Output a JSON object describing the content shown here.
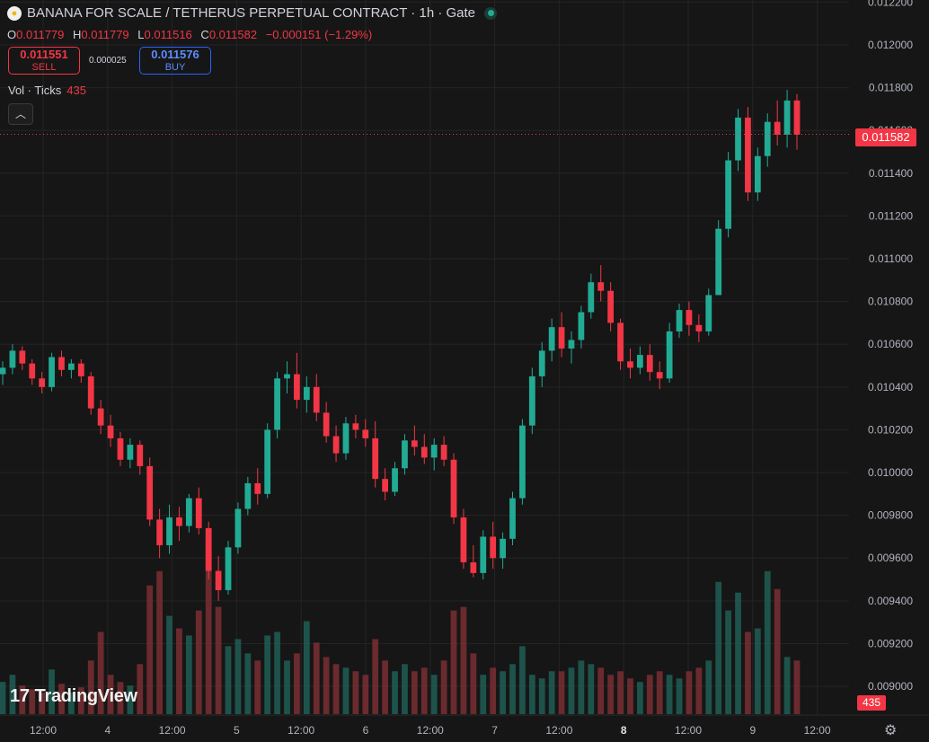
{
  "header": {
    "title": "BANANA FOR SCALE / TETHERUS PERPETUAL CONTRACT · 1h · Gate",
    "ohlc": [
      {
        "k": "O",
        "v": "0.011779"
      },
      {
        "k": "H",
        "v": "0.011779"
      },
      {
        "k": "L",
        "v": "0.011516"
      },
      {
        "k": "C",
        "v": "0.011582"
      },
      {
        "k": "",
        "v": "−0.000151 (−1.29%)"
      }
    ]
  },
  "trade": {
    "sell_price": "0.011551",
    "sell_label": "SELL",
    "spread": "0.000025",
    "buy_price": "0.011576",
    "buy_label": "BUY"
  },
  "volume_legend": {
    "label": "Vol · Ticks",
    "value": "435"
  },
  "collapse_icon": "chevron-up-icon",
  "last_price_label": "0.011582",
  "last_volume_label": "435",
  "branding": "TradingView",
  "settings_icon": "gear-icon",
  "colors": {
    "up": "#22ab94",
    "down": "#f23645",
    "up_vol": "#1f5e55",
    "down_vol": "#7a2e32",
    "grid": "#242424",
    "background": "#161616"
  },
  "chart_data": {
    "type": "candlestick",
    "timeframe": "1h",
    "y_ticks": [
      "0.012200",
      "0.012000",
      "0.011800",
      "0.011600",
      "0.011400",
      "0.011200",
      "0.011000",
      "0.010800",
      "0.010600",
      "0.010400",
      "0.010200",
      "0.010000",
      "0.009800",
      "0.009600",
      "0.009400",
      "0.009200",
      "0.009000"
    ],
    "x_ticks": [
      "12:00",
      "4",
      "12:00",
      "5",
      "12:00",
      "6",
      "12:00",
      "7",
      "12:00",
      "8",
      "12:00",
      "9",
      "12:00"
    ],
    "x_ticks_bold": [
      false,
      false,
      false,
      false,
      false,
      false,
      false,
      false,
      false,
      true,
      false,
      false,
      false
    ],
    "ylim": [
      0.00887,
      0.01221
    ],
    "last_price": 0.011582,
    "candles": [
      [
        0.01046,
        0.01052,
        0.01041,
        0.01049
      ],
      [
        0.01049,
        0.0106,
        0.01046,
        0.01057
      ],
      [
        0.01057,
        0.01059,
        0.01048,
        0.01051
      ],
      [
        0.01051,
        0.01053,
        0.01041,
        0.01044
      ],
      [
        0.01044,
        0.01047,
        0.01037,
        0.0104
      ],
      [
        0.0104,
        0.01056,
        0.01038,
        0.01054
      ],
      [
        0.01054,
        0.01057,
        0.01045,
        0.01048
      ],
      [
        0.01048,
        0.01053,
        0.01044,
        0.01051
      ],
      [
        0.01051,
        0.01053,
        0.01042,
        0.01045
      ],
      [
        0.01045,
        0.01047,
        0.01027,
        0.0103
      ],
      [
        0.0103,
        0.01034,
        0.01018,
        0.01022
      ],
      [
        0.01022,
        0.01027,
        0.01012,
        0.01016
      ],
      [
        0.01016,
        0.01019,
        0.01003,
        0.01006
      ],
      [
        0.01006,
        0.01016,
        0.01002,
        0.01013
      ],
      [
        0.01013,
        0.01015,
        0.00999,
        0.01003
      ],
      [
        0.01003,
        0.01007,
        0.00975,
        0.00978
      ],
      [
        0.00978,
        0.00983,
        0.0096,
        0.00966
      ],
      [
        0.00966,
        0.00985,
        0.00962,
        0.00979
      ],
      [
        0.00979,
        0.00984,
        0.00968,
        0.00975
      ],
      [
        0.00975,
        0.0099,
        0.00972,
        0.00988
      ],
      [
        0.00988,
        0.00993,
        0.00971,
        0.00974
      ],
      [
        0.00974,
        0.00977,
        0.0095,
        0.00954
      ],
      [
        0.00954,
        0.00961,
        0.0094,
        0.00945
      ],
      [
        0.00945,
        0.00968,
        0.00943,
        0.00965
      ],
      [
        0.00965,
        0.00986,
        0.00962,
        0.00983
      ],
      [
        0.00983,
        0.00998,
        0.0098,
        0.00995
      ],
      [
        0.00995,
        0.01002,
        0.00985,
        0.0099
      ],
      [
        0.0099,
        0.01023,
        0.00988,
        0.0102
      ],
      [
        0.0102,
        0.01047,
        0.01016,
        0.01044
      ],
      [
        0.01044,
        0.01052,
        0.01037,
        0.01046
      ],
      [
        0.01046,
        0.01056,
        0.0103,
        0.01034
      ],
      [
        0.01034,
        0.01045,
        0.01028,
        0.0104
      ],
      [
        0.0104,
        0.01046,
        0.01024,
        0.01028
      ],
      [
        0.01028,
        0.01033,
        0.01014,
        0.01017
      ],
      [
        0.01017,
        0.01022,
        0.01005,
        0.01009
      ],
      [
        0.01009,
        0.01026,
        0.01006,
        0.01023
      ],
      [
        0.01023,
        0.01027,
        0.01016,
        0.0102
      ],
      [
        0.0102,
        0.01025,
        0.01012,
        0.01016
      ],
      [
        0.01016,
        0.01024,
        0.00993,
        0.00997
      ],
      [
        0.00997,
        0.01002,
        0.00987,
        0.00991
      ],
      [
        0.00991,
        0.01005,
        0.00989,
        0.01002
      ],
      [
        0.01002,
        0.01018,
        0.00999,
        0.01015
      ],
      [
        0.01015,
        0.01022,
        0.01008,
        0.01012
      ],
      [
        0.01012,
        0.01018,
        0.01004,
        0.01007
      ],
      [
        0.01007,
        0.01016,
        0.01001,
        0.01013
      ],
      [
        0.01013,
        0.01017,
        0.01003,
        0.01006
      ],
      [
        0.01006,
        0.01009,
        0.00976,
        0.00979
      ],
      [
        0.00979,
        0.00983,
        0.00955,
        0.00958
      ],
      [
        0.00958,
        0.00966,
        0.00951,
        0.00953
      ],
      [
        0.00953,
        0.00973,
        0.0095,
        0.0097
      ],
      [
        0.0097,
        0.00977,
        0.00955,
        0.0096
      ],
      [
        0.0096,
        0.00972,
        0.00955,
        0.00969
      ],
      [
        0.00969,
        0.00991,
        0.00966,
        0.00988
      ],
      [
        0.00988,
        0.01025,
        0.00985,
        0.01022
      ],
      [
        0.01022,
        0.01049,
        0.01018,
        0.01045
      ],
      [
        0.01045,
        0.01061,
        0.0104,
        0.01057
      ],
      [
        0.01057,
        0.01072,
        0.01052,
        0.01068
      ],
      [
        0.01068,
        0.01075,
        0.01054,
        0.01058
      ],
      [
        0.01058,
        0.01066,
        0.01051,
        0.01062
      ],
      [
        0.01062,
        0.01078,
        0.01058,
        0.01075
      ],
      [
        0.01075,
        0.01093,
        0.01072,
        0.01089
      ],
      [
        0.01089,
        0.01097,
        0.0108,
        0.01085
      ],
      [
        0.01085,
        0.01089,
        0.01066,
        0.0107
      ],
      [
        0.0107,
        0.01072,
        0.01048,
        0.01052
      ],
      [
        0.01052,
        0.01058,
        0.01044,
        0.01049
      ],
      [
        0.01049,
        0.01059,
        0.01046,
        0.01055
      ],
      [
        0.01055,
        0.0106,
        0.01043,
        0.01047
      ],
      [
        0.01047,
        0.01052,
        0.01039,
        0.01044
      ],
      [
        0.01044,
        0.0107,
        0.01042,
        0.01066
      ],
      [
        0.01066,
        0.01079,
        0.01063,
        0.01076
      ],
      [
        0.01076,
        0.0108,
        0.01064,
        0.01069
      ],
      [
        0.01069,
        0.01074,
        0.01061,
        0.01066
      ],
      [
        0.01066,
        0.01086,
        0.01064,
        0.01083
      ],
      [
        0.01083,
        0.01085,
        0.01118,
        0.01114
      ],
      [
        0.01114,
        0.0115,
        0.0111,
        0.01146
      ],
      [
        0.01146,
        0.0117,
        0.01141,
        0.01166
      ],
      [
        0.01166,
        0.01171,
        0.01127,
        0.01131
      ],
      [
        0.01131,
        0.01152,
        0.01127,
        0.01148
      ],
      [
        0.01148,
        0.01168,
        0.01143,
        0.01164
      ],
      [
        0.01164,
        0.01174,
        0.01153,
        0.01158
      ],
      [
        0.01158,
        0.01179,
        0.01152,
        0.01174
      ],
      [
        0.01174,
        0.01177,
        0.01151,
        0.01158
      ]
    ],
    "volumes": [
      18,
      22,
      16,
      14,
      12,
      25,
      17,
      12,
      15,
      30,
      46,
      22,
      18,
      16,
      28,
      72,
      80,
      55,
      48,
      44,
      58,
      98,
      60,
      38,
      42,
      34,
      30,
      44,
      46,
      30,
      34,
      52,
      40,
      32,
      28,
      26,
      24,
      22,
      42,
      30,
      24,
      28,
      24,
      26,
      22,
      30,
      58,
      60,
      34,
      22,
      26,
      24,
      28,
      38,
      22,
      20,
      24,
      24,
      26,
      30,
      28,
      26,
      22,
      24,
      20,
      18,
      22,
      24,
      22,
      20,
      24,
      26,
      30,
      74,
      58,
      68,
      46,
      48,
      80,
      70,
      32,
      30
    ]
  }
}
